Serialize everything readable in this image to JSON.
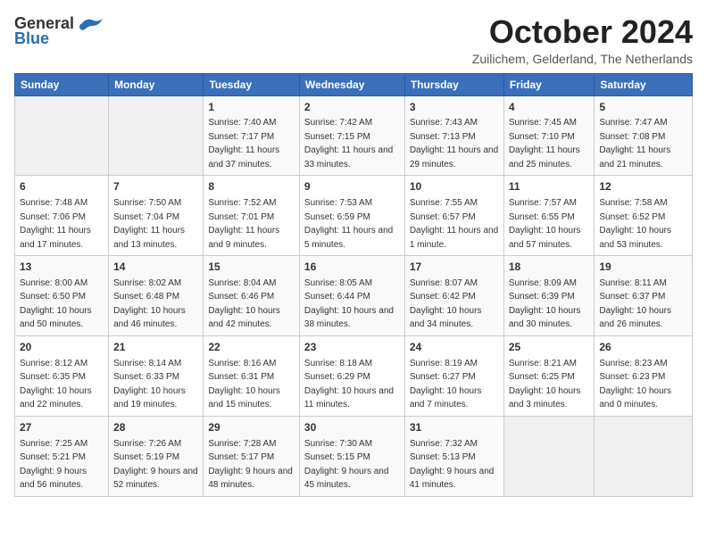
{
  "header": {
    "logo_general": "General",
    "logo_blue": "Blue",
    "month": "October 2024",
    "location": "Zuilichem, Gelderland, The Netherlands"
  },
  "days_of_week": [
    "Sunday",
    "Monday",
    "Tuesday",
    "Wednesday",
    "Thursday",
    "Friday",
    "Saturday"
  ],
  "weeks": [
    [
      {
        "day": "",
        "sunrise": "",
        "sunset": "",
        "daylight": ""
      },
      {
        "day": "",
        "sunrise": "",
        "sunset": "",
        "daylight": ""
      },
      {
        "day": "1",
        "sunrise": "Sunrise: 7:40 AM",
        "sunset": "Sunset: 7:17 PM",
        "daylight": "Daylight: 11 hours and 37 minutes."
      },
      {
        "day": "2",
        "sunrise": "Sunrise: 7:42 AM",
        "sunset": "Sunset: 7:15 PM",
        "daylight": "Daylight: 11 hours and 33 minutes."
      },
      {
        "day": "3",
        "sunrise": "Sunrise: 7:43 AM",
        "sunset": "Sunset: 7:13 PM",
        "daylight": "Daylight: 11 hours and 29 minutes."
      },
      {
        "day": "4",
        "sunrise": "Sunrise: 7:45 AM",
        "sunset": "Sunset: 7:10 PM",
        "daylight": "Daylight: 11 hours and 25 minutes."
      },
      {
        "day": "5",
        "sunrise": "Sunrise: 7:47 AM",
        "sunset": "Sunset: 7:08 PM",
        "daylight": "Daylight: 11 hours and 21 minutes."
      }
    ],
    [
      {
        "day": "6",
        "sunrise": "Sunrise: 7:48 AM",
        "sunset": "Sunset: 7:06 PM",
        "daylight": "Daylight: 11 hours and 17 minutes."
      },
      {
        "day": "7",
        "sunrise": "Sunrise: 7:50 AM",
        "sunset": "Sunset: 7:04 PM",
        "daylight": "Daylight: 11 hours and 13 minutes."
      },
      {
        "day": "8",
        "sunrise": "Sunrise: 7:52 AM",
        "sunset": "Sunset: 7:01 PM",
        "daylight": "Daylight: 11 hours and 9 minutes."
      },
      {
        "day": "9",
        "sunrise": "Sunrise: 7:53 AM",
        "sunset": "Sunset: 6:59 PM",
        "daylight": "Daylight: 11 hours and 5 minutes."
      },
      {
        "day": "10",
        "sunrise": "Sunrise: 7:55 AM",
        "sunset": "Sunset: 6:57 PM",
        "daylight": "Daylight: 11 hours and 1 minute."
      },
      {
        "day": "11",
        "sunrise": "Sunrise: 7:57 AM",
        "sunset": "Sunset: 6:55 PM",
        "daylight": "Daylight: 10 hours and 57 minutes."
      },
      {
        "day": "12",
        "sunrise": "Sunrise: 7:58 AM",
        "sunset": "Sunset: 6:52 PM",
        "daylight": "Daylight: 10 hours and 53 minutes."
      }
    ],
    [
      {
        "day": "13",
        "sunrise": "Sunrise: 8:00 AM",
        "sunset": "Sunset: 6:50 PM",
        "daylight": "Daylight: 10 hours and 50 minutes."
      },
      {
        "day": "14",
        "sunrise": "Sunrise: 8:02 AM",
        "sunset": "Sunset: 6:48 PM",
        "daylight": "Daylight: 10 hours and 46 minutes."
      },
      {
        "day": "15",
        "sunrise": "Sunrise: 8:04 AM",
        "sunset": "Sunset: 6:46 PM",
        "daylight": "Daylight: 10 hours and 42 minutes."
      },
      {
        "day": "16",
        "sunrise": "Sunrise: 8:05 AM",
        "sunset": "Sunset: 6:44 PM",
        "daylight": "Daylight: 10 hours and 38 minutes."
      },
      {
        "day": "17",
        "sunrise": "Sunrise: 8:07 AM",
        "sunset": "Sunset: 6:42 PM",
        "daylight": "Daylight: 10 hours and 34 minutes."
      },
      {
        "day": "18",
        "sunrise": "Sunrise: 8:09 AM",
        "sunset": "Sunset: 6:39 PM",
        "daylight": "Daylight: 10 hours and 30 minutes."
      },
      {
        "day": "19",
        "sunrise": "Sunrise: 8:11 AM",
        "sunset": "Sunset: 6:37 PM",
        "daylight": "Daylight: 10 hours and 26 minutes."
      }
    ],
    [
      {
        "day": "20",
        "sunrise": "Sunrise: 8:12 AM",
        "sunset": "Sunset: 6:35 PM",
        "daylight": "Daylight: 10 hours and 22 minutes."
      },
      {
        "day": "21",
        "sunrise": "Sunrise: 8:14 AM",
        "sunset": "Sunset: 6:33 PM",
        "daylight": "Daylight: 10 hours and 19 minutes."
      },
      {
        "day": "22",
        "sunrise": "Sunrise: 8:16 AM",
        "sunset": "Sunset: 6:31 PM",
        "daylight": "Daylight: 10 hours and 15 minutes."
      },
      {
        "day": "23",
        "sunrise": "Sunrise: 8:18 AM",
        "sunset": "Sunset: 6:29 PM",
        "daylight": "Daylight: 10 hours and 11 minutes."
      },
      {
        "day": "24",
        "sunrise": "Sunrise: 8:19 AM",
        "sunset": "Sunset: 6:27 PM",
        "daylight": "Daylight: 10 hours and 7 minutes."
      },
      {
        "day": "25",
        "sunrise": "Sunrise: 8:21 AM",
        "sunset": "Sunset: 6:25 PM",
        "daylight": "Daylight: 10 hours and 3 minutes."
      },
      {
        "day": "26",
        "sunrise": "Sunrise: 8:23 AM",
        "sunset": "Sunset: 6:23 PM",
        "daylight": "Daylight: 10 hours and 0 minutes."
      }
    ],
    [
      {
        "day": "27",
        "sunrise": "Sunrise: 7:25 AM",
        "sunset": "Sunset: 5:21 PM",
        "daylight": "Daylight: 9 hours and 56 minutes."
      },
      {
        "day": "28",
        "sunrise": "Sunrise: 7:26 AM",
        "sunset": "Sunset: 5:19 PM",
        "daylight": "Daylight: 9 hours and 52 minutes."
      },
      {
        "day": "29",
        "sunrise": "Sunrise: 7:28 AM",
        "sunset": "Sunset: 5:17 PM",
        "daylight": "Daylight: 9 hours and 48 minutes."
      },
      {
        "day": "30",
        "sunrise": "Sunrise: 7:30 AM",
        "sunset": "Sunset: 5:15 PM",
        "daylight": "Daylight: 9 hours and 45 minutes."
      },
      {
        "day": "31",
        "sunrise": "Sunrise: 7:32 AM",
        "sunset": "Sunset: 5:13 PM",
        "daylight": "Daylight: 9 hours and 41 minutes."
      },
      {
        "day": "",
        "sunrise": "",
        "sunset": "",
        "daylight": ""
      },
      {
        "day": "",
        "sunrise": "",
        "sunset": "",
        "daylight": ""
      }
    ]
  ]
}
